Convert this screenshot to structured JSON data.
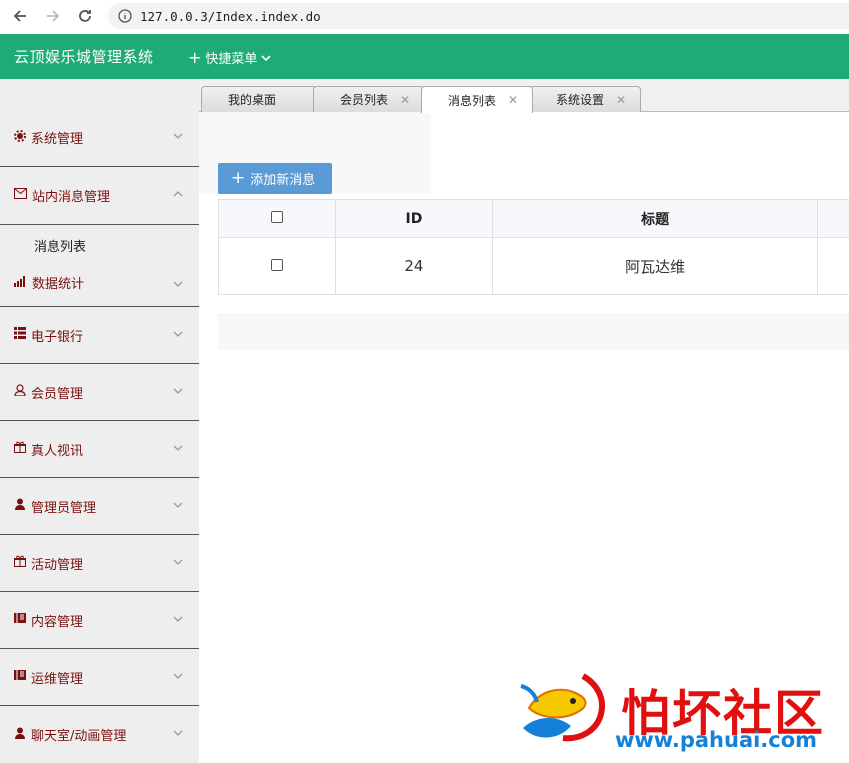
{
  "browser": {
    "url": "127.0.0.3/Index.index.do"
  },
  "header": {
    "title": "云顶娱乐城管理系统",
    "quick_menu": "快捷菜单"
  },
  "sidebar": {
    "items": [
      {
        "label": "系统管理",
        "icon": "gear-icon"
      },
      {
        "label": "站内消息管理",
        "icon": "envelope-icon"
      },
      {
        "label": "数据统计",
        "icon": "bar-chart-icon"
      },
      {
        "label": "电子银行",
        "icon": "list-icon"
      },
      {
        "label": "会员管理",
        "icon": "user-icon"
      },
      {
        "label": "真人视讯",
        "icon": "gift-icon"
      },
      {
        "label": "管理员管理",
        "icon": "user-solid-icon"
      },
      {
        "label": "活动管理",
        "icon": "gift-icon"
      },
      {
        "label": "内容管理",
        "icon": "book-icon"
      },
      {
        "label": "运维管理",
        "icon": "book-icon"
      },
      {
        "label": "聊天室/动画管理",
        "icon": "user-solid-icon"
      }
    ],
    "sub_item": "消息列表"
  },
  "tabs": [
    "我的桌面",
    "会员列表",
    "消息列表",
    "系统设置"
  ],
  "toolbar": {
    "add_label": "添加新消息"
  },
  "table": {
    "headers": [
      "ID",
      "标题"
    ],
    "rows": [
      {
        "id": "24",
        "title": "阿瓦达维"
      }
    ]
  },
  "watermark": {
    "title": "怕坏社区",
    "url": "www.pahuai.com"
  },
  "colors": {
    "header": "#1fab76",
    "menu_text": "#7a1010",
    "button": "#5b9bd5"
  }
}
